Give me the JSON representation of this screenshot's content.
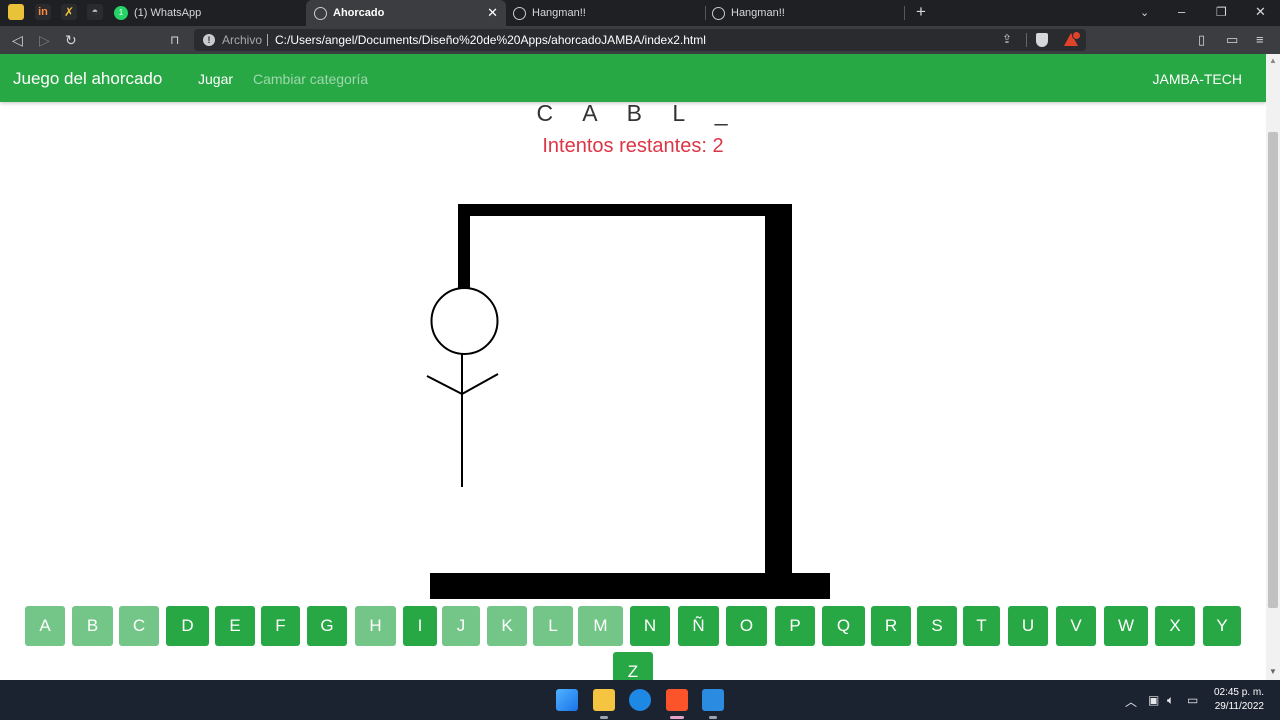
{
  "browser": {
    "tabs": [
      {
        "label": "(1) WhatsApp",
        "active": false
      },
      {
        "label": "Ahorcado",
        "active": true
      },
      {
        "label": "Hangman!!",
        "active": false
      },
      {
        "label": "Hangman!!",
        "active": false
      }
    ],
    "address": {
      "scheme_label": "Archivo",
      "path": "C:/Users/angel/Documents/Diseño%20de%20Apps/ahorcadoJAMBA/index2.html"
    },
    "new_tab": "+"
  },
  "page": {
    "navbar": {
      "brand": "Juego del ahorcado",
      "links": [
        {
          "label": "Jugar",
          "active": true
        },
        {
          "label": "Cambiar categoría",
          "active": false
        }
      ],
      "right_label": "JAMBA-TECH"
    },
    "word_display": "C A B L _",
    "attempts_text": "Intentos restantes: 2",
    "letters": [
      {
        "label": "A",
        "used": true
      },
      {
        "label": "B",
        "used": true
      },
      {
        "label": "C",
        "used": true
      },
      {
        "label": "D",
        "used": false
      },
      {
        "label": "E",
        "used": false
      },
      {
        "label": "F",
        "used": false
      },
      {
        "label": "G",
        "used": false
      },
      {
        "label": "H",
        "used": true
      },
      {
        "label": "I",
        "used": false
      },
      {
        "label": "J",
        "used": true
      },
      {
        "label": "K",
        "used": true
      },
      {
        "label": "L",
        "used": true
      },
      {
        "label": "M",
        "used": true
      },
      {
        "label": "N",
        "used": false
      },
      {
        "label": "Ñ",
        "used": false
      },
      {
        "label": "O",
        "used": false
      },
      {
        "label": "P",
        "used": false
      },
      {
        "label": "Q",
        "used": false
      },
      {
        "label": "R",
        "used": false
      },
      {
        "label": "S",
        "used": false
      },
      {
        "label": "T",
        "used": false
      },
      {
        "label": "U",
        "used": false
      },
      {
        "label": "V",
        "used": false
      },
      {
        "label": "W",
        "used": false
      },
      {
        "label": "X",
        "used": false
      },
      {
        "label": "Y",
        "used": false
      },
      {
        "label": "Z",
        "used": false
      }
    ],
    "colors": {
      "primary": "#28a745",
      "used": "#74c688",
      "danger": "#dc3545"
    }
  },
  "taskbar": {
    "clock_time": "02:45 p. m.",
    "clock_date": "29/11/2022"
  }
}
